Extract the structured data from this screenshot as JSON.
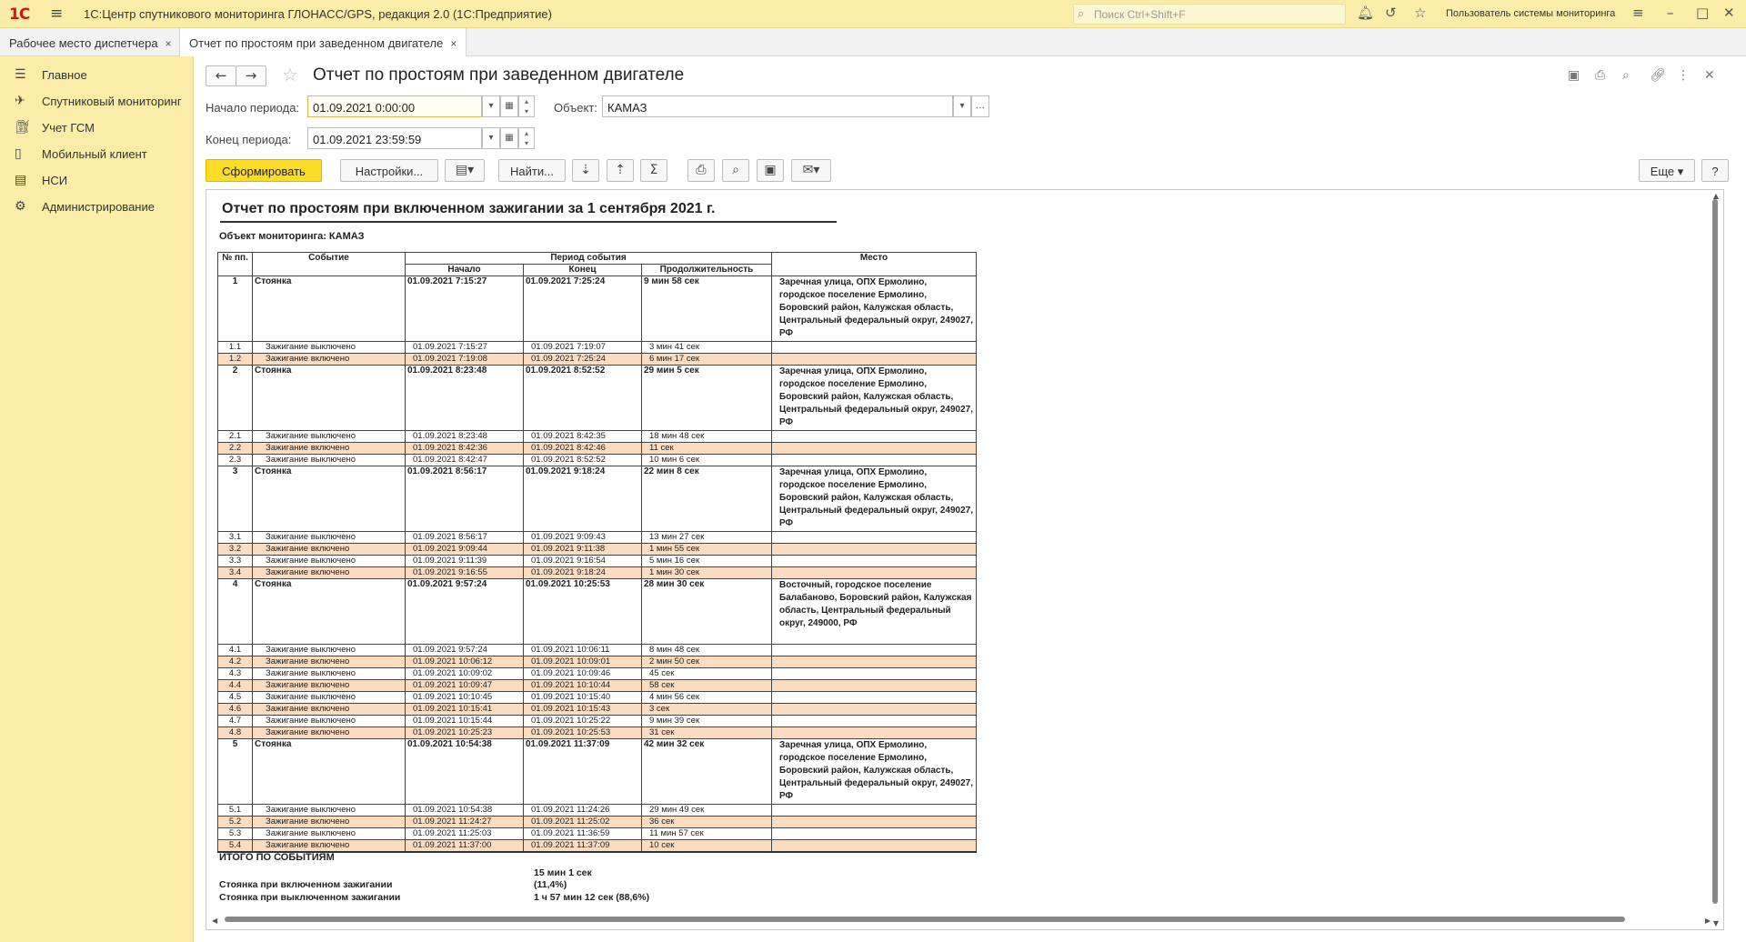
{
  "app": {
    "logo": "1С",
    "title": "1С:Центр спутникового мониторинга ГЛОНАСС/GPS, редакция 2.0  (1С:Предприятие)",
    "search_placeholder": "Поиск Ctrl+Shift+F",
    "user": "Пользователь системы мониторинга"
  },
  "tabs": [
    {
      "label": "Рабочее место диспетчера",
      "close": "×"
    },
    {
      "label": "Отчет по простоям при заведенном двигателе",
      "close": "×"
    }
  ],
  "sidebar": {
    "items": [
      {
        "label": "Главное",
        "icon": "menu-icon"
      },
      {
        "label": "Спутниковый мониторинг",
        "icon": "satellite-icon"
      },
      {
        "label": "Учет ГСМ",
        "icon": "fuel-icon"
      },
      {
        "label": "Мобильный клиент",
        "icon": "phone-icon"
      },
      {
        "label": "НСИ",
        "icon": "book-icon"
      },
      {
        "label": "Администрирование",
        "icon": "gear-icon"
      }
    ]
  },
  "form": {
    "title": "Отчет по простоям при заведенном двигателе",
    "period_start_label": "Начало периода:",
    "period_start_value": "01.09.2021  0:00:00",
    "period_end_label": "Конец периода:",
    "period_end_value": "01.09.2021 23:59:59",
    "object_label": "Объект:",
    "object_value": "КАМАЗ",
    "buttons": {
      "generate": "Сформировать",
      "settings": "Настройки...",
      "find": "Найти...",
      "more": "Еще",
      "help": "?"
    }
  },
  "report": {
    "title": "Отчет по простоям при включенном зажигании за 1 сентября 2021 г.",
    "object": "Объект мониторинга: КАМАЗ",
    "headers": {
      "num": "№ пп.",
      "event": "Событие",
      "period": "Период события",
      "start": "Начало",
      "end": "Конец",
      "duration": "Продолжительность",
      "place": "Место"
    },
    "rows": [
      {
        "type": "main",
        "n": "1",
        "event": "Стоянка",
        "start": "01.09.2021 7:15:27",
        "end": "01.09.2021 7:25:24",
        "dur": "9 мин 58 сек",
        "place": "Заречная улица, ОПХ Ермолино, городское поселение Ермолино, Боровский район, Калужская область, Центральный федеральный округ, 249027, РФ"
      },
      {
        "type": "sub",
        "n": "1.1",
        "event": "Зажигание выключено",
        "start": "01.09.2021 7:15:27",
        "end": "01.09.2021 7:19:07",
        "dur": "3 мин 41 сек"
      },
      {
        "type": "sub",
        "n": "1.2",
        "event": "Зажигание включено",
        "start": "01.09.2021 7:19:08",
        "end": "01.09.2021 7:25:24",
        "dur": "6 мин 17 сек"
      },
      {
        "type": "main",
        "n": "2",
        "event": "Стоянка",
        "start": "01.09.2021 8:23:48",
        "end": "01.09.2021 8:52:52",
        "dur": "29 мин 5 сек",
        "place": "Заречная улица, ОПХ Ермолино, городское поселение Ермолино, Боровский район, Калужская область, Центральный федеральный округ, 249027, РФ"
      },
      {
        "type": "sub",
        "n": "2.1",
        "event": "Зажигание выключено",
        "start": "01.09.2021 8:23:48",
        "end": "01.09.2021 8:42:35",
        "dur": "18 мин 48 сек"
      },
      {
        "type": "sub",
        "n": "2.2",
        "event": "Зажигание включено",
        "start": "01.09.2021 8:42:36",
        "end": "01.09.2021 8:42:46",
        "dur": "11 сек"
      },
      {
        "type": "sub",
        "n": "2.3",
        "event": "Зажигание выключено",
        "start": "01.09.2021 8:42:47",
        "end": "01.09.2021 8:52:52",
        "dur": "10 мин 6 сек"
      },
      {
        "type": "main",
        "n": "3",
        "event": "Стоянка",
        "start": "01.09.2021 8:56:17",
        "end": "01.09.2021 9:18:24",
        "dur": "22 мин 8 сек",
        "place": "Заречная улица, ОПХ Ермолино, городское поселение Ермолино, Боровский район, Калужская область, Центральный федеральный округ, 249027, РФ"
      },
      {
        "type": "sub",
        "n": "3.1",
        "event": "Зажигание выключено",
        "start": "01.09.2021 8:56:17",
        "end": "01.09.2021 9:09:43",
        "dur": "13 мин 27 сек"
      },
      {
        "type": "sub",
        "n": "3.2",
        "event": "Зажигание включено",
        "start": "01.09.2021 9:09:44",
        "end": "01.09.2021 9:11:38",
        "dur": "1 мин 55 сек"
      },
      {
        "type": "sub",
        "n": "3.3",
        "event": "Зажигание выключено",
        "start": "01.09.2021 9:11:39",
        "end": "01.09.2021 9:16:54",
        "dur": "5 мин 16 сек"
      },
      {
        "type": "sub",
        "n": "3.4",
        "event": "Зажигание включено",
        "start": "01.09.2021 9:16:55",
        "end": "01.09.2021 9:18:24",
        "dur": "1 мин 30 сек"
      },
      {
        "type": "main",
        "n": "4",
        "event": "Стоянка",
        "start": "01.09.2021 9:57:24",
        "end": "01.09.2021 10:25:53",
        "dur": "28 мин 30 сек",
        "place": "Восточный, городское поселение Балабаново, Боровский район, Калужская область, Центральный федеральный округ, 249000, РФ"
      },
      {
        "type": "sub",
        "n": "4.1",
        "event": "Зажигание выключено",
        "start": "01.09.2021 9:57:24",
        "end": "01.09.2021 10:06:11",
        "dur": "8 мин 48 сек"
      },
      {
        "type": "sub",
        "n": "4.2",
        "event": "Зажигание включено",
        "start": "01.09.2021 10:06:12",
        "end": "01.09.2021 10:09:01",
        "dur": "2 мин 50 сек"
      },
      {
        "type": "sub",
        "n": "4.3",
        "event": "Зажигание выключено",
        "start": "01.09.2021 10:09:02",
        "end": "01.09.2021 10:09:46",
        "dur": "45 сек"
      },
      {
        "type": "sub",
        "n": "4.4",
        "event": "Зажигание включено",
        "start": "01.09.2021 10:09:47",
        "end": "01.09.2021 10:10:44",
        "dur": "58 сек"
      },
      {
        "type": "sub",
        "n": "4.5",
        "event": "Зажигание выключено",
        "start": "01.09.2021 10:10:45",
        "end": "01.09.2021 10:15:40",
        "dur": "4 мин 56 сек"
      },
      {
        "type": "sub",
        "n": "4.6",
        "event": "Зажигание включено",
        "start": "01.09.2021 10:15:41",
        "end": "01.09.2021 10:15:43",
        "dur": "3 сек"
      },
      {
        "type": "sub",
        "n": "4.7",
        "event": "Зажигание выключено",
        "start": "01.09.2021 10:15:44",
        "end": "01.09.2021 10:25:22",
        "dur": "9 мин 39 сек"
      },
      {
        "type": "sub",
        "n": "4.8",
        "event": "Зажигание включено",
        "start": "01.09.2021 10:25:23",
        "end": "01.09.2021 10:25:53",
        "dur": "31 сек"
      },
      {
        "type": "main",
        "n": "5",
        "event": "Стоянка",
        "start": "01.09.2021 10:54:38",
        "end": "01.09.2021 11:37:09",
        "dur": "42 мин 32 сек",
        "place": "Заречная улица, ОПХ Ермолино, городское поселение Ермолино, Боровский район, Калужская область, Центральный федеральный округ, 249027, РФ"
      },
      {
        "type": "sub",
        "n": "5.1",
        "event": "Зажигание выключено",
        "start": "01.09.2021 10:54:38",
        "end": "01.09.2021 11:24:26",
        "dur": "29 мин 49 сек"
      },
      {
        "type": "sub",
        "n": "5.2",
        "event": "Зажигание включено",
        "start": "01.09.2021 11:24:27",
        "end": "01.09.2021 11:25:02",
        "dur": "36 сек"
      },
      {
        "type": "sub",
        "n": "5.3",
        "event": "Зажигание выключено",
        "start": "01.09.2021 11:25:03",
        "end": "01.09.2021 11:36:59",
        "dur": "11 мин 57 сек"
      },
      {
        "type": "sub",
        "n": "5.4",
        "event": "Зажигание включено",
        "start": "01.09.2021 11:37:00",
        "end": "01.09.2021 11:37:09",
        "dur": "10 сек"
      }
    ],
    "totals": {
      "heading": "ИТОГО ПО СОБЫТИЯМ",
      "on_label": "Стоянка при включенном зажигании",
      "on_value": "15 мин 1 сек",
      "on_pct": "(11,4%)",
      "off_label": "Стоянка при выключенном зажигании",
      "off_value": "1 ч 57 мин 12 сек (88,6%)"
    }
  },
  "colors": {
    "accent_yellow": "#fbeda8",
    "primary_button": "#fbdd28",
    "highlight_row": "#fbdcc0"
  }
}
